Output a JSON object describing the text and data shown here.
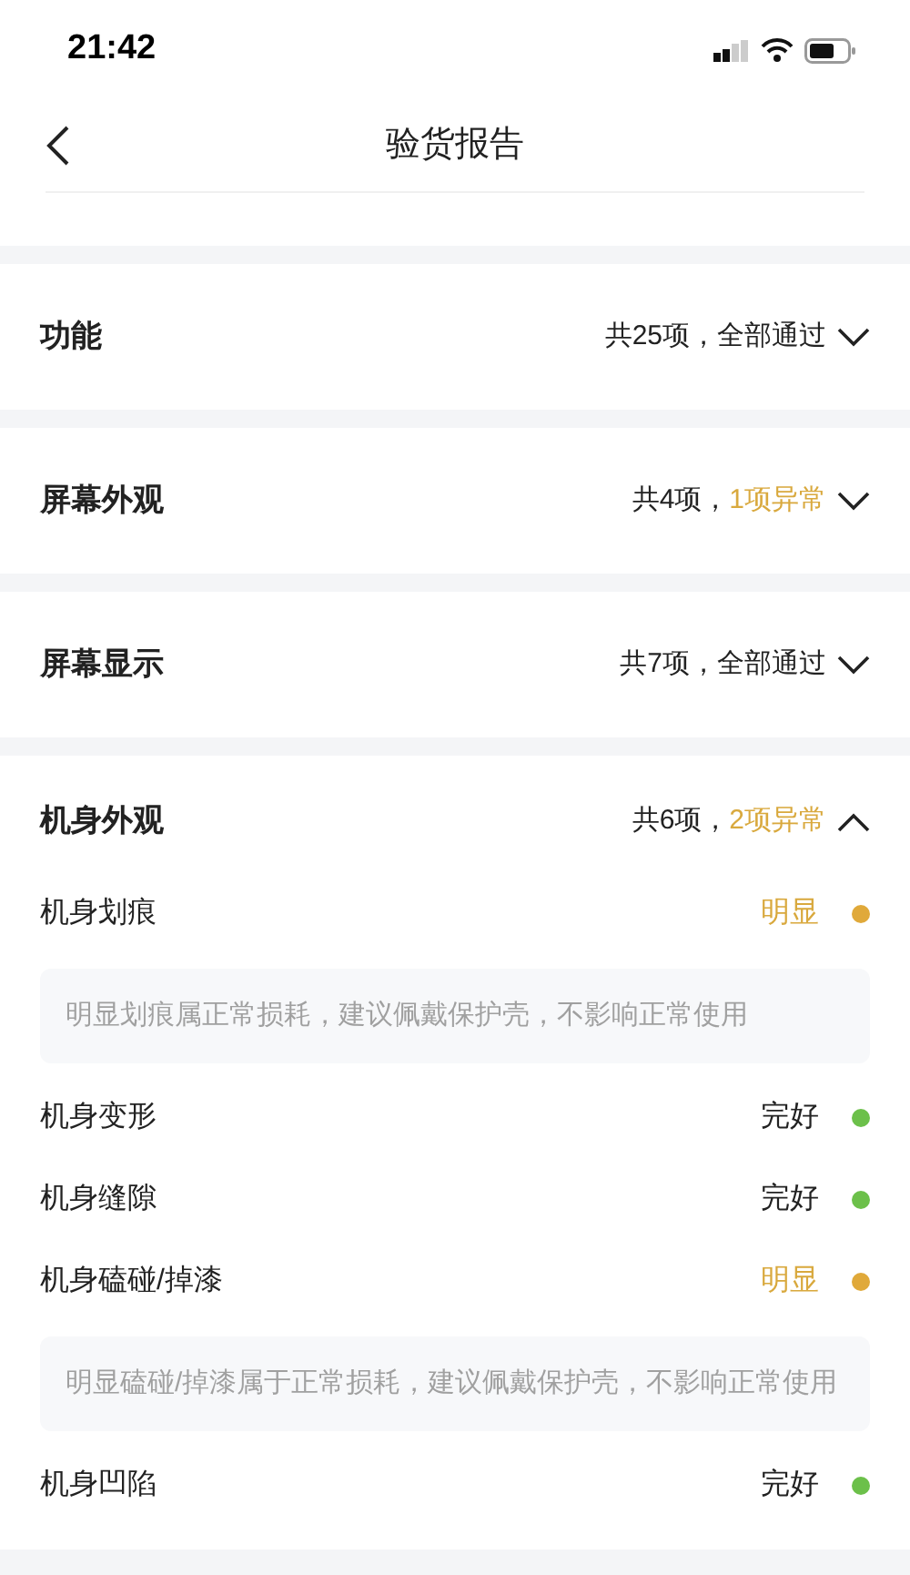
{
  "status_bar": {
    "time": "21:42"
  },
  "nav": {
    "title": "验货报告"
  },
  "sections": [
    {
      "title": "功能",
      "count": "共25项，",
      "status": "全部通过",
      "abnormal": false,
      "expanded": false
    },
    {
      "title": "屏幕外观",
      "count": "共4项，",
      "status": "1项异常",
      "abnormal": true,
      "expanded": false
    },
    {
      "title": "屏幕显示",
      "count": "共7项，",
      "status": "全部通过",
      "abnormal": false,
      "expanded": false
    },
    {
      "title": "机身外观",
      "count": "共6项，",
      "status": "2项异常",
      "abnormal": true,
      "expanded": true,
      "items": [
        {
          "name": "机身划痕",
          "result": "明显",
          "kind": "obvious",
          "color": "#e0a93a",
          "note": "明显划痕属正常损耗，建议佩戴保护壳，不影响正常使用"
        },
        {
          "name": "机身变形",
          "result": "完好",
          "kind": "good",
          "color": "#6cc04a"
        },
        {
          "name": "机身缝隙",
          "result": "完好",
          "kind": "good",
          "color": "#6cc04a"
        },
        {
          "name": "机身磕碰/掉漆",
          "result": "明显",
          "kind": "obvious",
          "color": "#e0a93a",
          "note": "明显磕碰/掉漆属于正常损耗，建议佩戴保护壳，不影响正常使用"
        },
        {
          "name": "机身凹陷",
          "result": "完好",
          "kind": "good",
          "color": "#6cc04a"
        }
      ]
    }
  ]
}
